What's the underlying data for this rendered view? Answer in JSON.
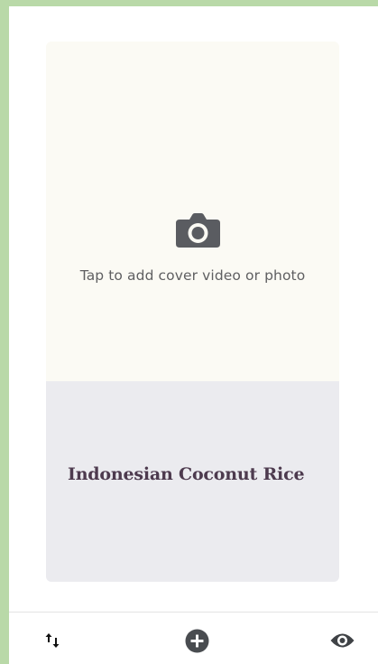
{
  "cover": {
    "prompt": "Tap to add cover video or photo",
    "icon": "camera-icon",
    "background_color": "#fbfaf4"
  },
  "recipe": {
    "title": "Indonesian Coconut Rice",
    "title_color": "#4d3a4e",
    "background_color": "#ebebef"
  },
  "toolbar": {
    "reorder_icon": "reorder-arrows-icon",
    "add_icon": "add-circle-icon",
    "preview_icon": "eye-icon"
  }
}
